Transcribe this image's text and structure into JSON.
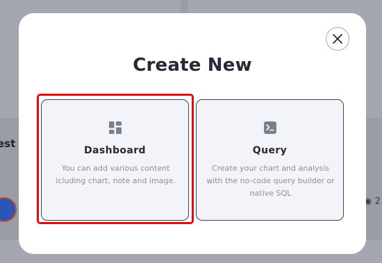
{
  "background": {
    "partial_text": "est",
    "eye_count": "2"
  },
  "modal": {
    "title": "Create New",
    "close_icon": "close-icon",
    "options": [
      {
        "title": "Dashboard",
        "description": "You can add various content icluding chart, note and image.",
        "icon": "dashboard-grid-icon",
        "selected": true
      },
      {
        "title": "Query",
        "description": "Create your chart and analysis with the no-code query builder or native SQL",
        "icon": "terminal-icon",
        "selected": false
      }
    ]
  },
  "colors": {
    "selection_outline": "#e00d0d",
    "card_background": "#f3f4f9",
    "icon_color": "#7a7f8e"
  }
}
